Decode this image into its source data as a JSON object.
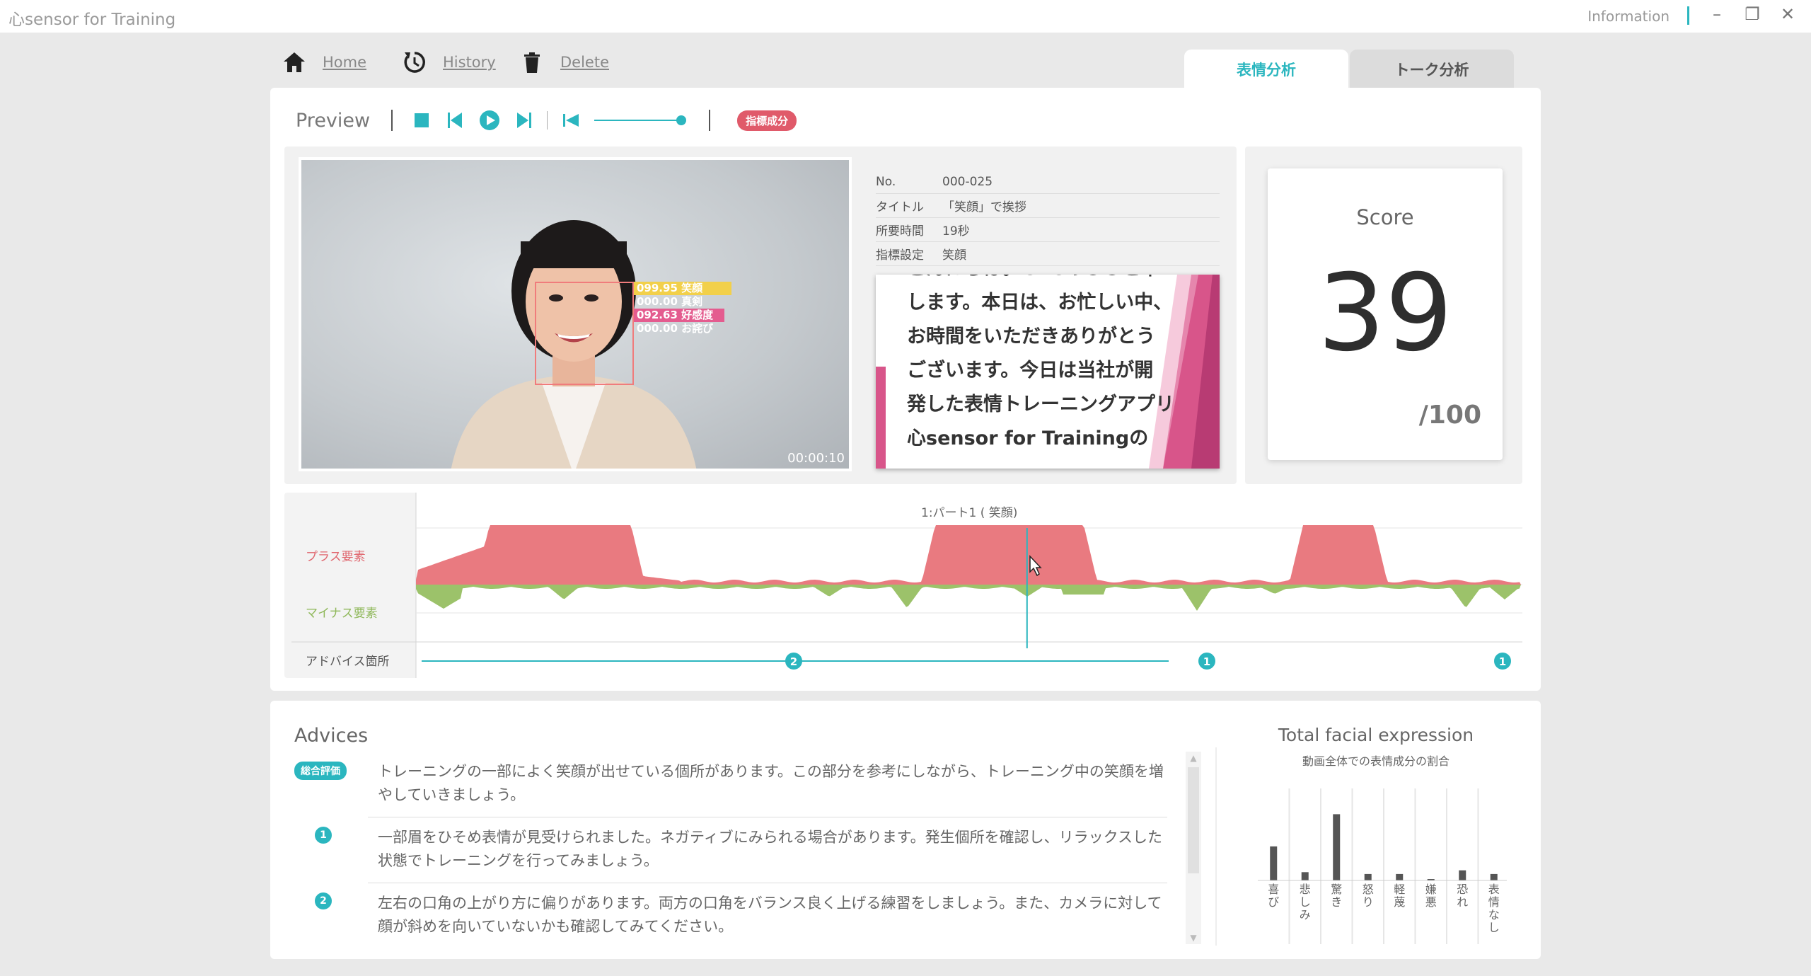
{
  "window": {
    "title": "心sensor for Training",
    "info_label": "Information",
    "minimize": "–",
    "restore": "❐",
    "close": "✕"
  },
  "nav": {
    "home": "Home",
    "history": "History",
    "delete": "Delete"
  },
  "tabs": [
    {
      "label": "表情分析",
      "active": true
    },
    {
      "label": "トーク分析",
      "active": false
    }
  ],
  "toolbar": {
    "preview_label": "Preview",
    "indicator_badge": "指標成分",
    "volume_level": 1.0
  },
  "video": {
    "timecode": "00:00:10",
    "face_labels": [
      {
        "text": "099.95 笑顔",
        "color": "#f2d04a"
      },
      {
        "text": "000.00 真剣",
        "color": "#ffffff"
      },
      {
        "text": "092.63 好感度",
        "color": "#e45c8f"
      },
      {
        "text": "000.00 お詫び",
        "color": "#ffffff"
      }
    ]
  },
  "info": [
    {
      "key": "No.",
      "value": "000-025"
    },
    {
      "key": "タイトル",
      "value": "「笑顔」で挨拶"
    },
    {
      "key": "所要時間",
      "value": "19秒"
    },
    {
      "key": "指標設定",
      "value": "笑顔"
    }
  ],
  "slide": {
    "lines": [
      "こんにちは。CACのＯＯと申",
      "します。本日は、お忙しい中、",
      "お時間をいただきありがとう",
      "ございます。今日は当社が開",
      "発した表情トレーニングアプリ",
      "心sensor for Trainingの"
    ]
  },
  "score": {
    "label": "Score",
    "value": "39",
    "max": "/100"
  },
  "timeline": {
    "part_label": "1:パート1 ( 笑顔)",
    "plus_label": "プラス要素",
    "minus_label": "マイナス要素",
    "advice_label": "アドバイス箇所",
    "markers": [
      "2",
      "1",
      "1"
    ],
    "playhead_fraction": 0.553,
    "colors": {
      "plus": "#e97a80",
      "minus": "#9cc26a",
      "accent": "#2bb6bf"
    }
  },
  "advices": {
    "title": "Advices",
    "overall_badge": "総合評価",
    "items": [
      {
        "marker": "",
        "text": "トレーニングの一部によく笑顔が出せている個所があります。この部分を参考にしながら、トレーニング中の笑顔を増やしていきましょう。"
      },
      {
        "marker": "1",
        "text": "一部眉をひそめ表情が見受けられました。ネガティブにみられる場合があります。発生個所を確認し、リラックスした状態でトレーニングを行ってみましょう。"
      },
      {
        "marker": "2",
        "text": "左右の口角の上がり方に偏りがあります。両方の口角をバランス良く上げる練習をしましょう。また、カメラに対して顔が斜めを向いていないかも確認してみてください。"
      }
    ]
  },
  "chart_data": {
    "type": "bar",
    "title": "Total facial expression",
    "subtitle": "動画全体での表情成分の割合",
    "categories": [
      "喜び",
      "悲しみ",
      "驚き",
      "怒り",
      "軽蔑",
      "嫌悪",
      "恐れ",
      "表情なし"
    ],
    "values": [
      0.37,
      0.09,
      0.72,
      0.07,
      0.07,
      0.01,
      0.11,
      0.07
    ],
    "ylim": [
      0,
      1
    ],
    "bar_color": "#555555"
  }
}
